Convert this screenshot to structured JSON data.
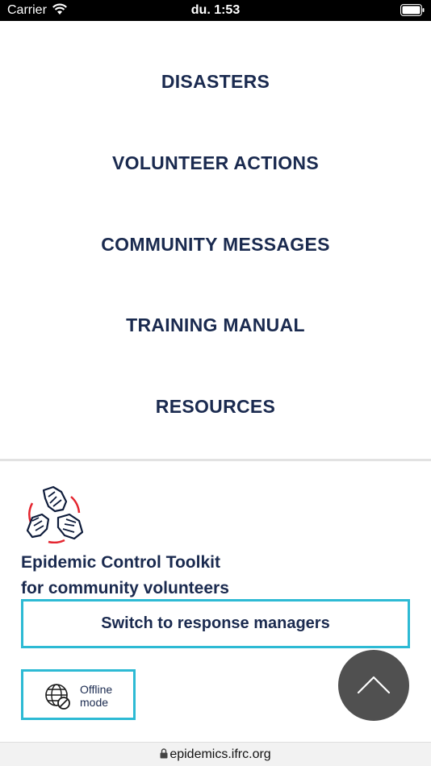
{
  "status_bar": {
    "carrier": "Carrier",
    "time": "du. 1:53"
  },
  "nav": {
    "items": [
      {
        "label": "DISASTERS"
      },
      {
        "label": "VOLUNTEER ACTIONS"
      },
      {
        "label": "COMMUNITY MESSAGES"
      },
      {
        "label": "TRAINING MANUAL"
      },
      {
        "label": "RESOURCES"
      }
    ]
  },
  "footer": {
    "logo_icon": "hands-circle-logo-icon",
    "title_line1": "Epidemic Control Toolkit",
    "title_line2": "for community volunteers",
    "switch_label": "Switch to response managers",
    "offline_icon": "globe-offline-icon",
    "offline_label_line1": "Offline",
    "offline_label_line2": "mode",
    "scroll_top_icon": "chevron-up-icon"
  },
  "browser": {
    "url": "epidemics.ifrc.org"
  },
  "colors": {
    "navy": "#1a2a4f",
    "accent": "#2dbad4",
    "logo_red": "#e4252f",
    "scroll_button": "#505050"
  }
}
